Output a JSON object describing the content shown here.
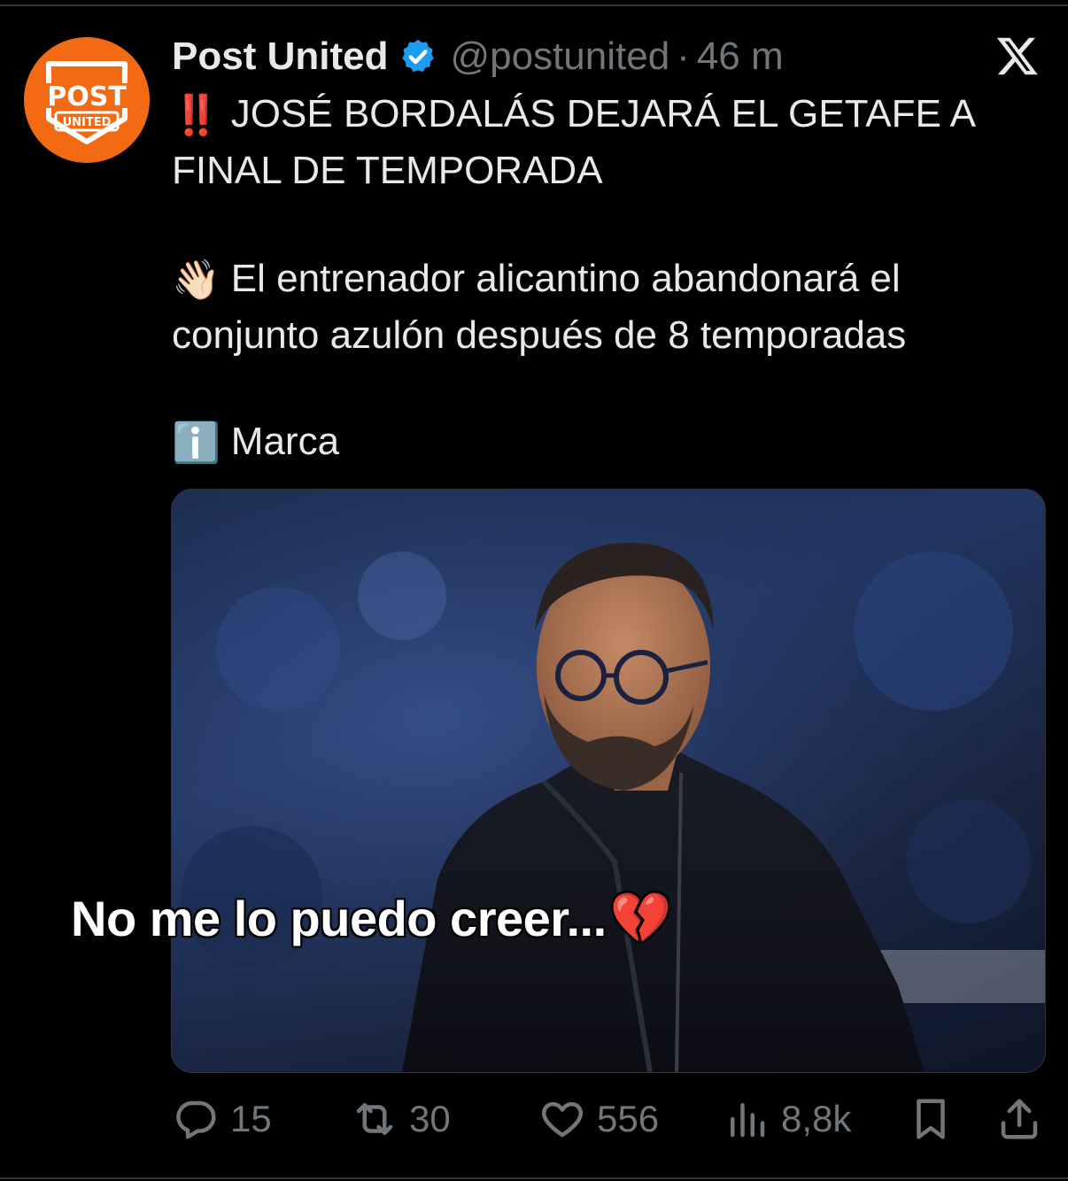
{
  "tweet": {
    "display_name": "Post United",
    "handle": "@postunited",
    "separator": "·",
    "time": "46 m",
    "avatar": {
      "top_text": "POST",
      "bottom_text": "UNITED",
      "color": "#f26a13"
    },
    "lines": {
      "headline_emoji": "‼️",
      "headline": "JOSÉ BORDALÁS DEJARÁ EL GETAFE A FINAL DE TEMPORADA",
      "body_emoji": "👋🏻",
      "body": "El entrenador alicantino abandonará el conjunto azulón después de 8 temporadas",
      "source_emoji": "ℹ️",
      "source": "Marca"
    },
    "media": {
      "overlay_caption": "No me lo puedo creer...",
      "overlay_emoji": "💔"
    },
    "actions": {
      "replies": "15",
      "reposts": "30",
      "likes": "556",
      "views": "8,8k"
    }
  },
  "icons": {
    "verified": "verified-badge-icon",
    "platform": "x-logo-icon",
    "reply": "reply-icon",
    "repost": "repost-icon",
    "like": "heart-icon",
    "views": "views-icon",
    "bookmark": "bookmark-icon",
    "share": "share-icon"
  },
  "colors": {
    "background": "#000000",
    "text": "#e7e9ea",
    "muted": "#71767b",
    "verified": "#1d9bf0",
    "brand": "#f26a13"
  }
}
